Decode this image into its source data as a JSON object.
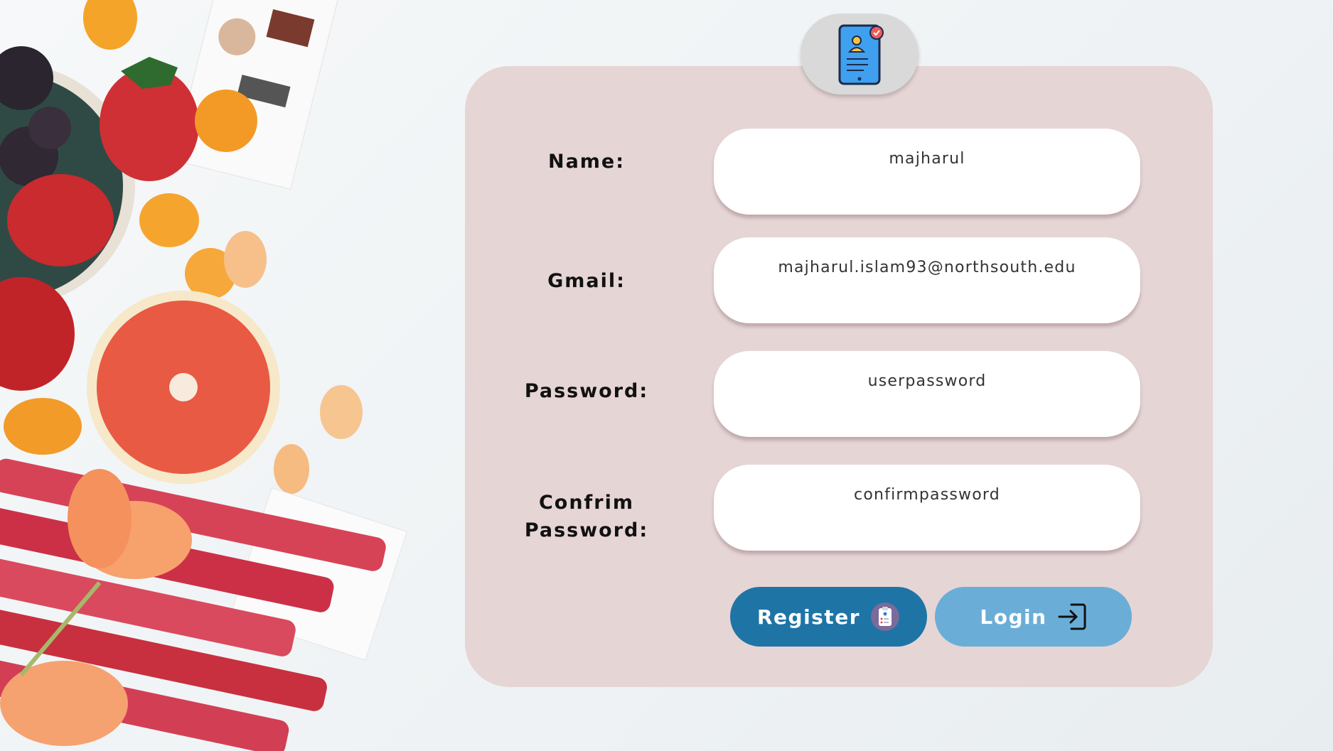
{
  "form": {
    "fields": [
      {
        "label": "Name:",
        "value": "majharul"
      },
      {
        "label": "Gmail:",
        "value": "majharul.islam93@northsouth.edu"
      },
      {
        "label": "Password:",
        "value": "userpassword"
      },
      {
        "label_line1": "Confrim",
        "label_line2": "Password:",
        "value": "confirmpassword"
      }
    ],
    "register_label": "Register",
    "login_label": "Login"
  },
  "icons": {
    "badge": "mobile-profile-form-icon",
    "register": "clipboard-icon",
    "login": "sign-in-icon"
  },
  "colors": {
    "card": "#e6d5d5",
    "register_button": "#1f74a6",
    "login_button": "#6aaed8",
    "badge": "#d9d9d9"
  }
}
